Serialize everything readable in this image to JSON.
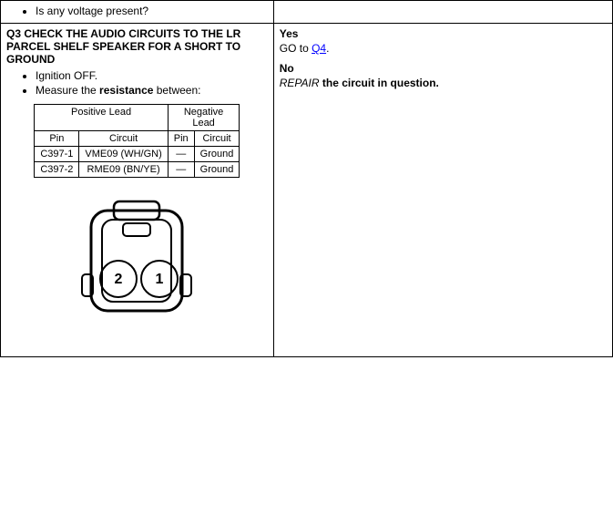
{
  "page": {
    "prevRow": {
      "leftContent": "Is any voltage present?",
      "rightContent": ""
    },
    "q3": {
      "header": "Q3 CHECK THE AUDIO CIRCUITS TO THE LR PARCEL SHELF SPEAKER FOR A SHORT TO GROUND",
      "bullets": [
        "Ignition OFF.",
        "Measure the resistance between:"
      ],
      "tableHeaders": {
        "positiveLead": "Positive Lead",
        "negativeLead": "Negative Lead",
        "pin": "Pin",
        "circuit": "Circuit"
      },
      "tableRows": [
        {
          "posPin": "C397-1",
          "posCircuit": "VME09 (WH/GN)",
          "negPin": "—",
          "negCircuit": "Ground"
        },
        {
          "posPin": "C397-2",
          "posCircuit": "RME09 (BN/YE)",
          "negPin": "—",
          "negCircuit": "Ground"
        }
      ],
      "connectorLabel1": "2",
      "connectorLabel2": "1"
    },
    "answers": {
      "yes": {
        "label": "Yes",
        "text": "GO to ",
        "link": "Q4",
        "linkHref": "#Q4"
      },
      "no": {
        "label": "No",
        "repairWord": "REPAIR",
        "restText": " the circuit in question."
      }
    }
  }
}
